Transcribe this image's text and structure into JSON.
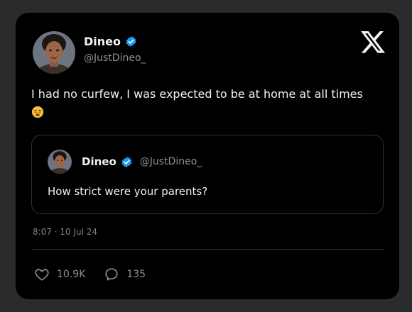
{
  "author": {
    "name": "Dineo",
    "handle": "@JustDineo_",
    "verified_color": "#1d9bf0"
  },
  "tweet": {
    "text": "I had no curfew, I was expected to be at home at all times",
    "emoji": "weary-face-emoji"
  },
  "quoted": {
    "name": "Dineo",
    "handle": "@JustDineo_",
    "text": "How strict were your parents?"
  },
  "timestamp": "8:07 · 10 Jul 24",
  "actions": {
    "likes": "10.9K",
    "replies": "135"
  },
  "icons": {
    "logo": "x-logo-icon",
    "verified": "verified-badge-icon",
    "like": "heart-icon",
    "reply": "reply-icon"
  }
}
